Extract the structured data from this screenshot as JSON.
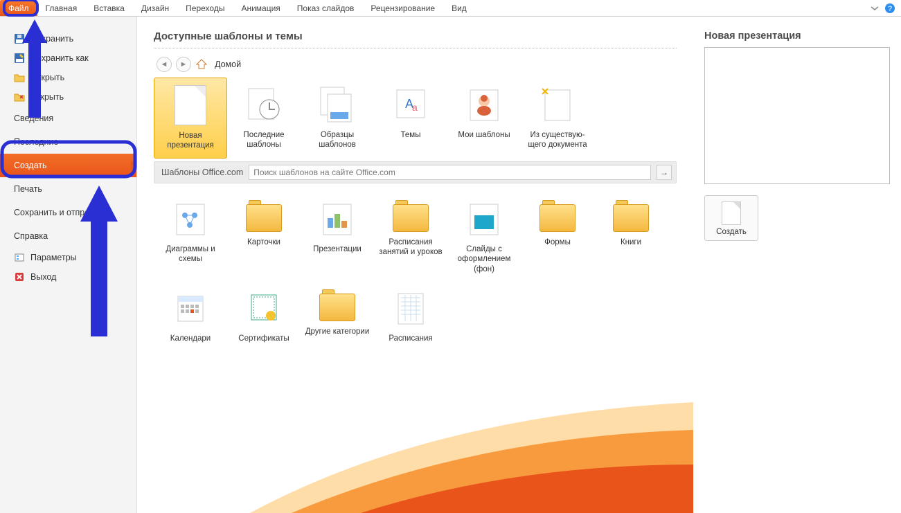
{
  "ribbon": {
    "file": "Файл",
    "tabs": [
      "Главная",
      "Вставка",
      "Дизайн",
      "Переходы",
      "Анимация",
      "Показ слайдов",
      "Рецензирование",
      "Вид"
    ]
  },
  "backstage": {
    "save": "Сохранить",
    "save_as": "Сохранить как",
    "open": "Открыть",
    "close": "Закрыть",
    "info": "Сведения",
    "recent": "Последние",
    "new": "Создать",
    "print": "Печать",
    "share": "Сохранить и отправить",
    "help": "Справка",
    "options": "Параметры",
    "exit": "Выход"
  },
  "content": {
    "title": "Доступные шаблоны и темы",
    "home": "Домой",
    "row1": [
      {
        "id": "blank",
        "label": "Новая презентация",
        "selected": true
      },
      {
        "id": "recent",
        "label": "Последние шаблоны"
      },
      {
        "id": "samples",
        "label": "Образцы шаблонов"
      },
      {
        "id": "themes",
        "label": "Темы"
      },
      {
        "id": "my",
        "label": "Мои шаблоны"
      },
      {
        "id": "existing",
        "label": "Из существую-\nщего документа"
      }
    ],
    "officecom_label": "Шаблоны Office.com",
    "search_placeholder": "Поиск шаблонов на сайте Office.com",
    "row2": [
      {
        "label": "Диаграммы и схемы"
      },
      {
        "label": "Карточки"
      },
      {
        "label": "Презентации"
      },
      {
        "label": "Расписания занятий и уроков"
      },
      {
        "label": "Слайды с оформлением (фон)"
      },
      {
        "label": "Формы"
      },
      {
        "label": "Книги"
      }
    ],
    "row3": [
      {
        "label": "Календари"
      },
      {
        "label": "Сертификаты"
      },
      {
        "label": "Другие категории"
      },
      {
        "label": "Расписания"
      }
    ]
  },
  "right": {
    "title": "Новая презентация",
    "create": "Создать"
  }
}
